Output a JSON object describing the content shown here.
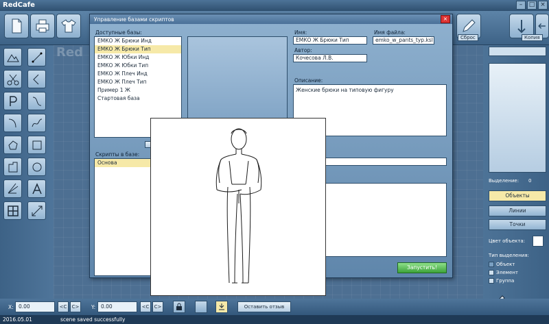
{
  "app": {
    "title": "RedCafe"
  },
  "topbar": {
    "reset_label": "Сброс",
    "copy_label": "Копия"
  },
  "workspace": {
    "watermark": "Red"
  },
  "dialog": {
    "title": "Управление базами скриптов",
    "available_bases_label": "Доступные базы:",
    "bases": [
      {
        "label": "ЕМКО Ж Брюки Инд",
        "selected": false
      },
      {
        "label": "ЕМКО Ж Брюки Тип",
        "selected": true
      },
      {
        "label": "ЕМКО Ж Юбки Инд",
        "selected": false
      },
      {
        "label": "ЕМКО Ж Юбки Тип",
        "selected": false
      },
      {
        "label": "ЕМКО Ж Плеч Инд",
        "selected": false
      },
      {
        "label": "ЕМКО Ж Плеч Тип",
        "selected": false
      },
      {
        "label": "Пример 1 Ж",
        "selected": false
      },
      {
        "label": "Стартовая база",
        "selected": false
      }
    ],
    "scripts_label": "Скрипты в базе:",
    "scripts": [
      {
        "label": "Основа",
        "selected": true
      }
    ],
    "name_label": "Имя:",
    "name_value": "ЕМКО Ж Брюки Тип",
    "filename_label": "Имя файла:",
    "filename_value": "emko_w_pants_typ.ksl",
    "author_label": "Автор:",
    "author_value": "Кочесова Л.В.",
    "description_label": "Описание:",
    "description_value": "Женские брюки на типовую фигуру",
    "run_label": "Запустить!"
  },
  "rightpanel": {
    "selection_label": "Выделение:",
    "selection_count": "0",
    "objects_label": "Объекты",
    "lines_label": "Линии",
    "points_label": "Точки",
    "object_color_label": "Цвет объекта:",
    "selection_type_label": "Тип выделения:",
    "selection_types": [
      {
        "label": "Объект",
        "checked": true
      },
      {
        "label": "Элемент",
        "checked": false
      },
      {
        "label": "Группа",
        "checked": false
      }
    ]
  },
  "bottombar": {
    "x_label": "X:",
    "x_value": "0.00",
    "y_label": "Y:",
    "y_value": "0.00",
    "prev_label": "<C",
    "next_label": "C>",
    "feedback_label": "Оставить отзыв"
  },
  "status": {
    "date": "2016.05.01",
    "message": "scene saved successfully"
  },
  "colors": {
    "accent_yellow": "#f6e9a8",
    "run_green": "#3da33a",
    "close_red": "#dd3333"
  }
}
